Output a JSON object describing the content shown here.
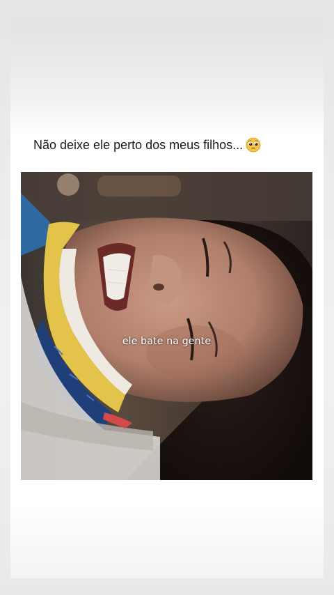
{
  "post": {
    "caption": "Não deixe ele perto dos meus filhos...",
    "caption_emoji": "pleading-face-emoji"
  },
  "video": {
    "subtitle": "ele bate na gente"
  },
  "colors": {
    "card_background": "#ffffff",
    "page_background": "#ebebeb",
    "text": "#1a1a1a"
  }
}
